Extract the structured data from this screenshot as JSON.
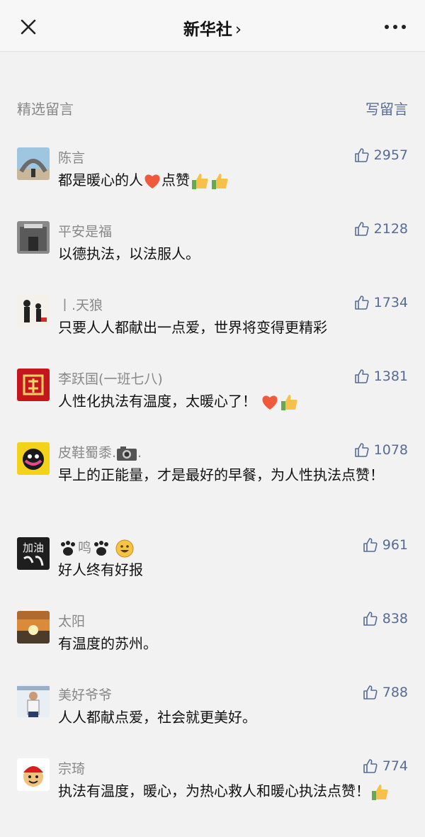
{
  "header": {
    "title": "新华社",
    "chevron": "›"
  },
  "section": {
    "title": "精选留言",
    "write_label": "写留言"
  },
  "comments": [
    {
      "nickname": "陈言",
      "text": "都是暖心的人",
      "text2": "点赞",
      "likes": "2957",
      "avatar_icon": "rainbow-arch-photo"
    },
    {
      "nickname": "平安是福",
      "text": "以德执法，以法服人。",
      "likes": "2128",
      "avatar_icon": "building-gate-photo"
    },
    {
      "nickname": "丨.天狼",
      "text": "只要人人都献出一点爱，世界将变得更精彩",
      "likes": "1734",
      "avatar_icon": "silhouette-photo"
    },
    {
      "nickname": "李跃国(一班七八)",
      "text": "人性化执法有温度，太暖心了！",
      "likes": "1381",
      "avatar_icon": "red-character-photo"
    },
    {
      "nickname": "皮鞋蜀黍.",
      "nickname_suffix": ".",
      "text": "早上的正能量，才是最好的早餐，为人性执法点赞！",
      "likes": "1078",
      "avatar_icon": "cartoon-character-photo"
    },
    {
      "nickname": "鸣",
      "text": "好人终有好报",
      "likes": "961",
      "avatar_icon": "calligraphy-photo",
      "avatar_text": "加油"
    },
    {
      "nickname": "太阳",
      "text": "有温度的苏州。",
      "likes": "838",
      "avatar_icon": "sunset-photo"
    },
    {
      "nickname": "美好爷爷",
      "text": "人人都献点爱，社会就更美好。",
      "likes": "788",
      "avatar_icon": "man-portrait-photo"
    },
    {
      "nickname": "宗琦",
      "text": "执法有温度，暖心，为热心救人和暖心执法点赞！",
      "likes": "774",
      "avatar_icon": "cartoon-boy-photo"
    }
  ],
  "colors": {
    "link": "#576b95",
    "meta": "#888888",
    "background": "#f2f2f2"
  }
}
